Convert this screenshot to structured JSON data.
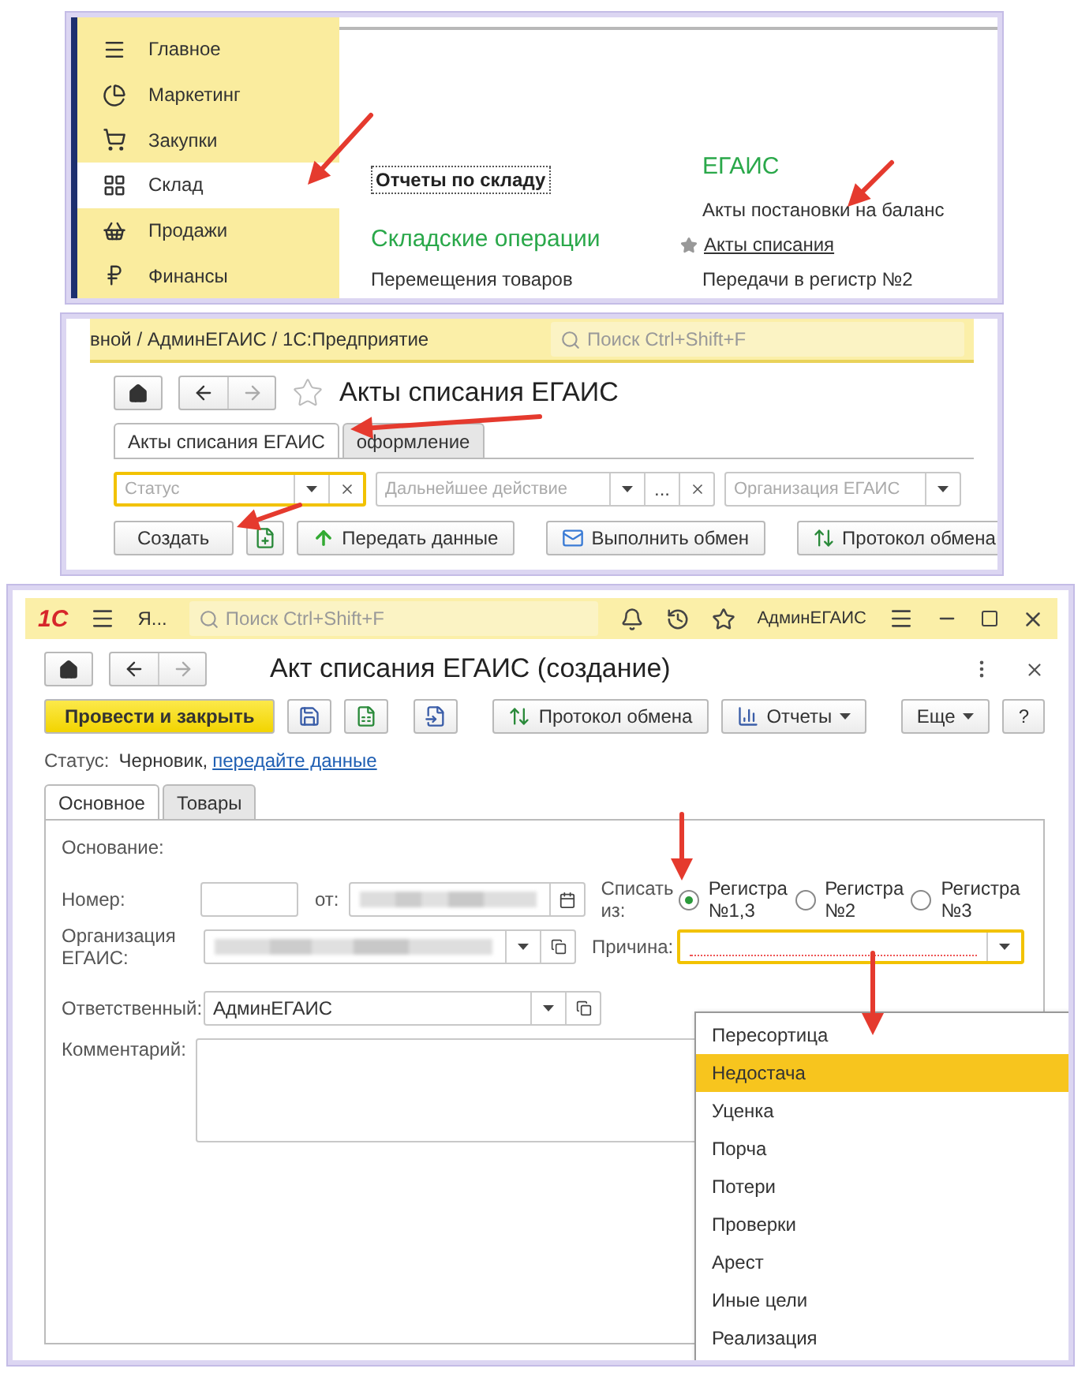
{
  "nav_panel": {
    "sidebar": [
      {
        "label": "Главное",
        "selected": false
      },
      {
        "label": "Маркетинг",
        "selected": false
      },
      {
        "label": "Закупки",
        "selected": false
      },
      {
        "label": "Склад",
        "selected": true
      },
      {
        "label": "Продажи",
        "selected": false
      },
      {
        "label": "Финансы",
        "selected": false
      }
    ],
    "column_1": {
      "report_link": "Отчеты по складу",
      "heading": "Складские операции",
      "items": [
        "Перемещения товаров"
      ]
    },
    "column_2": {
      "heading": "ЕГАИС",
      "items": [
        {
          "label": "Акты постановки на баланс",
          "favorite": false
        },
        {
          "label": "Акты списания",
          "favorite": true
        },
        {
          "label": "Передачи в регистр №2",
          "favorite": false
        }
      ]
    }
  },
  "list_window": {
    "title_bar": "вной / АдминЕГАИС / 1С:Предприятие",
    "search": {
      "placeholder": "Поиск Ctrl+Shift+F"
    },
    "title": "Акты списания ЕГАИС",
    "tabs": [
      {
        "label": "Акты списания ЕГАИС",
        "selected": true
      },
      {
        "label": "оформление",
        "selected": false
      }
    ],
    "filters": [
      {
        "placeholder": "Статус",
        "focused": true
      },
      {
        "placeholder": "Дальнейшее действие",
        "focused": false,
        "ellipsis": "..."
      },
      {
        "placeholder": "Организация ЕГАИС",
        "focused": false
      }
    ],
    "buttons": [
      {
        "kind": "text",
        "label": "Создать"
      },
      {
        "kind": "icon"
      },
      {
        "kind": "upload",
        "label": "Передать данные"
      },
      {
        "kind": "exchange",
        "label": "Выполнить обмен"
      },
      {
        "kind": "protocol",
        "label": "Протокол обмена"
      }
    ]
  },
  "form_window": {
    "logo": "1С",
    "app_tab": "Я...",
    "search": {
      "placeholder": "Поиск Ctrl+Shift+F"
    },
    "user": "АдминЕГАИС",
    "title": "Акт списания ЕГАИС (создание)",
    "toolbar": [
      {
        "kind": "primary",
        "label": "Провести и закрыть"
      },
      {
        "kind": "save"
      },
      {
        "kind": "doc"
      },
      {
        "kind": "go"
      },
      {
        "kind": "protocol",
        "label": "Протокол обмена"
      },
      {
        "kind": "reports",
        "label": "Отчеты"
      },
      {
        "kind": "more",
        "label": "Еще"
      },
      {
        "kind": "help",
        "label": "?"
      }
    ],
    "status": {
      "label": "Статус:",
      "value": "Черновик,",
      "link": "передайте данные"
    },
    "tabs": [
      {
        "label": "Основное",
        "selected": true
      },
      {
        "label": "Товары",
        "selected": false
      }
    ],
    "basis_label": "Основание:",
    "number_label": "Номер:",
    "date_label": "от:",
    "org_label": "Организация ЕГАИС:",
    "responsible_label": "Ответственный:",
    "responsible_value": "АдминЕГАИС",
    "comment_label": "Комментарий:",
    "source_label": "Списать из:",
    "sources": [
      {
        "label": "Регистра №1,3",
        "selected": true
      },
      {
        "label": "Регистра №2",
        "selected": false
      },
      {
        "label": "Регистра №3",
        "selected": false
      }
    ],
    "reason_label": "Причина:",
    "reasons": [
      {
        "label": "Пересортица",
        "selected": false
      },
      {
        "label": "Недостача",
        "selected": true
      },
      {
        "label": "Уценка",
        "selected": false
      },
      {
        "label": "Порча",
        "selected": false
      },
      {
        "label": "Потери",
        "selected": false
      },
      {
        "label": "Проверки",
        "selected": false
      },
      {
        "label": "Арест",
        "selected": false
      },
      {
        "label": "Иные цели",
        "selected": false
      },
      {
        "label": "Реализация",
        "selected": false
      }
    ]
  }
}
